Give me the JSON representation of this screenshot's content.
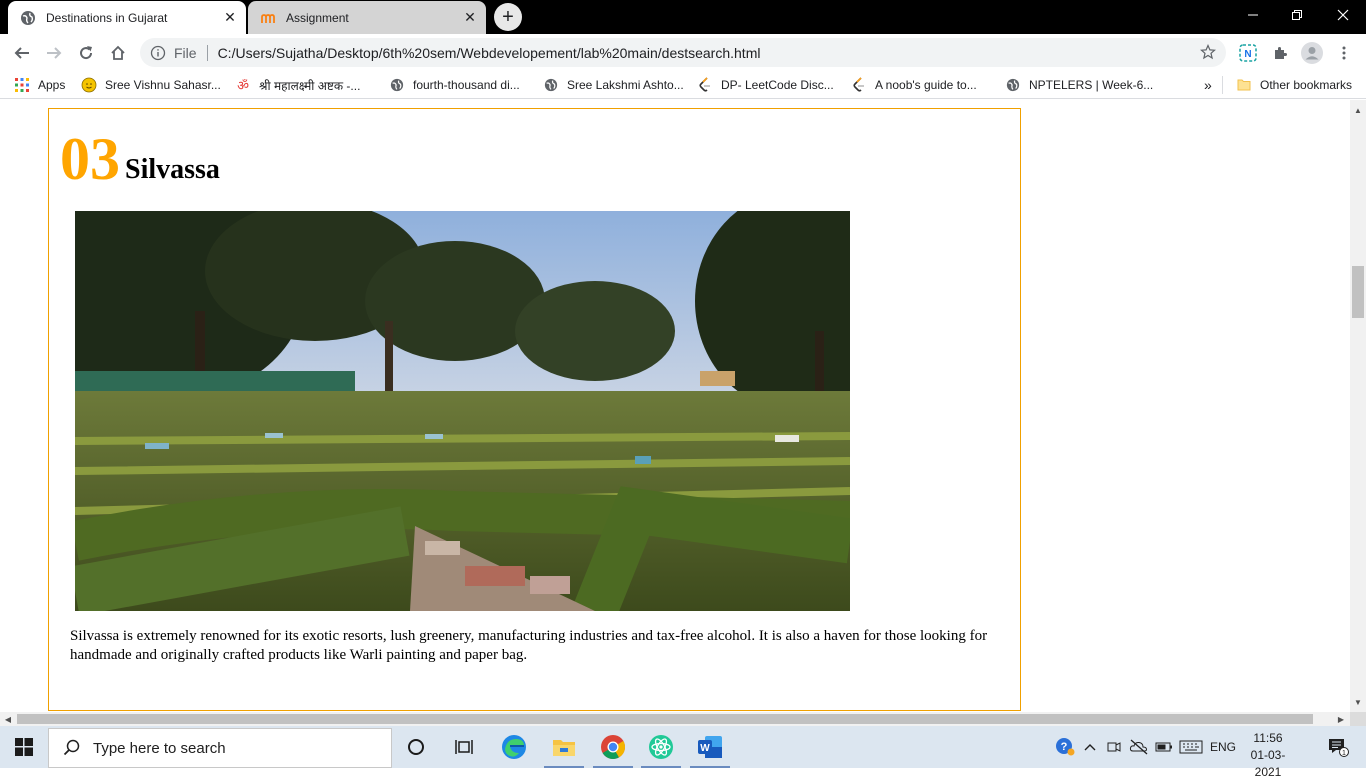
{
  "browser": {
    "tabs": [
      {
        "title": "Destinations in Gujarat",
        "active": true,
        "icon": "globe-icon"
      },
      {
        "title": "Assignment",
        "active": false,
        "icon": "moodle-icon"
      }
    ],
    "url_scheme": "File",
    "url": "C:/Users/Sujatha/Desktop/6th%20sem/Webdevelopement/lab%20main/destsearch.html",
    "bookmarks": [
      {
        "label": "Apps",
        "icon": "apps-grid-icon"
      },
      {
        "label": "Sree Vishnu Sahasr...",
        "icon": "smiley-icon"
      },
      {
        "label": "श्री महालक्ष्मी अष्टक -...",
        "icon": "om-icon"
      },
      {
        "label": "fourth-thousand di...",
        "icon": "globe-icon"
      },
      {
        "label": "Sree Lakshmi Ashto...",
        "icon": "globe-icon"
      },
      {
        "label": "DP- LeetCode Disc...",
        "icon": "leetcode-icon"
      },
      {
        "label": "A noob's guide to...",
        "icon": "leetcode-icon"
      },
      {
        "label": "NPTELERS | Week-6...",
        "icon": "globe-icon"
      }
    ],
    "overflow_label": "»",
    "other_bookmarks": "Other bookmarks",
    "accent_color": "#ffa500"
  },
  "page": {
    "number": "03",
    "name": "Silvassa",
    "description": "Silvassa is extremely renowned for its exotic resorts, lush greenery, manufacturing industries and tax-free alcohol. It is also a haven for those looking for handmade and originally crafted products like Warli painting and paper bag."
  },
  "taskbar": {
    "search_placeholder": "Type here to search",
    "language": "ENG",
    "time": "11:56",
    "date": "01-03-2021",
    "notification_count": "1"
  }
}
